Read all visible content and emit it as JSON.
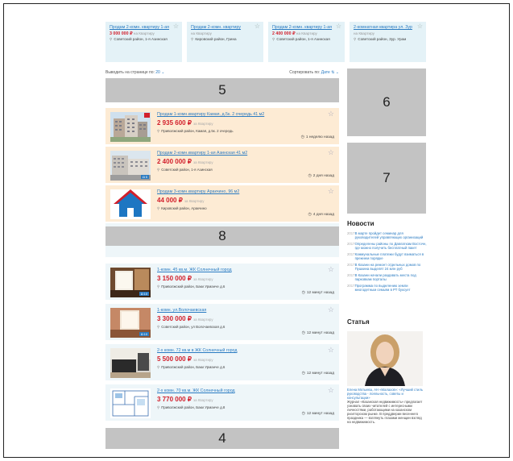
{
  "promos": [
    {
      "title": "Продам 2-комн. квартиру 1-ая",
      "price": "3 000 000",
      "per": "на Квартиру",
      "loc": "Советский район, 1-я Азинская"
    },
    {
      "title": "Продам 2-комн. квартиру",
      "price": "",
      "per": "на Квартиру",
      "loc": "Кировский район, Грина"
    },
    {
      "title": "Продам 2-комн. квартиру 1-ая",
      "price": "2 400 000",
      "per": "на Квартиру",
      "loc": "Советский район, 1-я Азинская"
    },
    {
      "title": "2-комнатная квартира ул. Зур",
      "price": "",
      "per": "на Квартиру",
      "loc": "Советский район, Зур. Урам"
    }
  ],
  "currency": "₽",
  "controls": {
    "per_page_label": "Выводить на странице по:",
    "per_page_value": "20",
    "sort_label": "Сортировать по:",
    "sort_value": "Дате"
  },
  "banners": {
    "b5": "5",
    "b6": "6",
    "b7": "7",
    "b8": "8",
    "b4": "4"
  },
  "listings": [
    {
      "title": "Продам 1-комн.квартиру Камая, д.5к. 2 очередь 41 м2",
      "price": "2 935 600",
      "per": "за Квартиру",
      "loc": "Приволжский район, Камая, д.5к. 2 очередь",
      "time": "1 неделю назад",
      "photos": ""
    },
    {
      "title": "Продам 2-комн.квартиру 1-ая Азинская 41 м2",
      "price": "2 400 000",
      "per": "за Квартиру",
      "loc": "Советский район, 1-я Азинская",
      "time": "2 дня назад",
      "photos": "5"
    },
    {
      "title": "Продам 3-комн.квартиру Аракчино, 96 м2",
      "price": "44 000",
      "per": "за Квартиру",
      "loc": "Кировский район, Аракчино",
      "time": "4 дня назад",
      "photos": ""
    },
    {
      "title": "1-комн. 45 кв.м. ЖК Солнечный город",
      "price": "3 150 000",
      "per": "за Квартиру",
      "loc": "Приволжский район, Баки Урманче д.6",
      "time": "12 минут назад",
      "photos": "10"
    },
    {
      "title": "1-комн. ул.Волочаевская",
      "price": "3 300 000",
      "per": "за Квартиру",
      "loc": "Советский район, ул Волочаевская д.6",
      "time": "12 минут назад",
      "photos": "10"
    },
    {
      "title": "2-х комн. 72 кв.м в ЖК Солнечный город",
      "price": "5 500 000",
      "per": "за Квартиру",
      "loc": "Приволжский район, Баки Урманче д.6",
      "time": "12 минут назад",
      "photos": ""
    },
    {
      "title": "2-х комн. 70 кв.м. ЖК Солнечный город",
      "price": "3 770 000",
      "per": "за Квартиру",
      "loc": "Приволжский район, Баки Урманче д.8",
      "time": "12 минут назад",
      "photos": ""
    }
  ],
  "news_title": "Новости",
  "news": [
    {
      "date": "2017",
      "text": "В марте пройдет семинар для руководителей управляющих организаций"
    },
    {
      "date": "2017",
      "text": "Определены районы по Давлаткам Восточн, где можно получить бесплатный пакет"
    },
    {
      "date": "2017",
      "text": "Коммунальные платежи будут взиматься в прежнем порядке"
    },
    {
      "date": "2017",
      "text": "В Казани на ремонт отдельных домов по Пушкина выделят 24 млн руб"
    },
    {
      "date": "2017",
      "text": "В Казани начали раздавать места под парковкам порталы"
    },
    {
      "date": "2017",
      "text": "Программа по выделению земли многодетным семьям в РТ буксует"
    }
  ],
  "article_title": "Статья",
  "article": {
    "author": "Елена Мотыева, АН «Малахов»: «Лучший стиль руководства - лояльность, советы и консультации»",
    "body": "Журнал «Казанская недвижимость» предлагает узнавать своих читателей с интересными личностями, работающими на казанском риэлторском рынке. В преддверии весеннего праздника — взглянуть глазами женщин взгляд на недвижимость."
  }
}
